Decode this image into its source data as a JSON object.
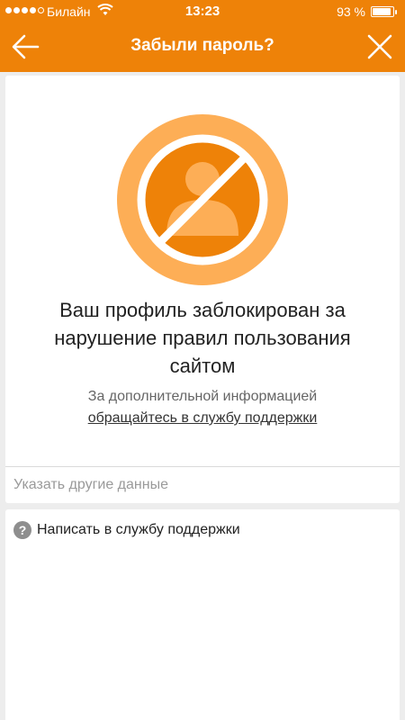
{
  "status_bar": {
    "carrier": "Билайн",
    "time": "13:23",
    "battery_percent": "93 %",
    "battery_level": 0.93,
    "signal_icon": "signal-dots-icon",
    "wifi_icon": "wifi-icon"
  },
  "header": {
    "title": "Забыли пароль?",
    "back_icon": "arrow-left-icon",
    "close_icon": "close-icon"
  },
  "blocked": {
    "icon": "blocked-profile-icon",
    "title": "Ваш профиль заблокирован за нарушение правил пользования сайтом",
    "subtitle_prefix": "За дополнительной информацией",
    "support_link": "обращайтесь в службу поддержки"
  },
  "other_data_label": "Указать другие данные",
  "help": {
    "icon_glyph": "?",
    "label": "Написать в службу поддержки"
  },
  "colors": {
    "brand": "#ee8208",
    "icon_light": "#fdae56",
    "icon_dark": "#ee8208"
  }
}
